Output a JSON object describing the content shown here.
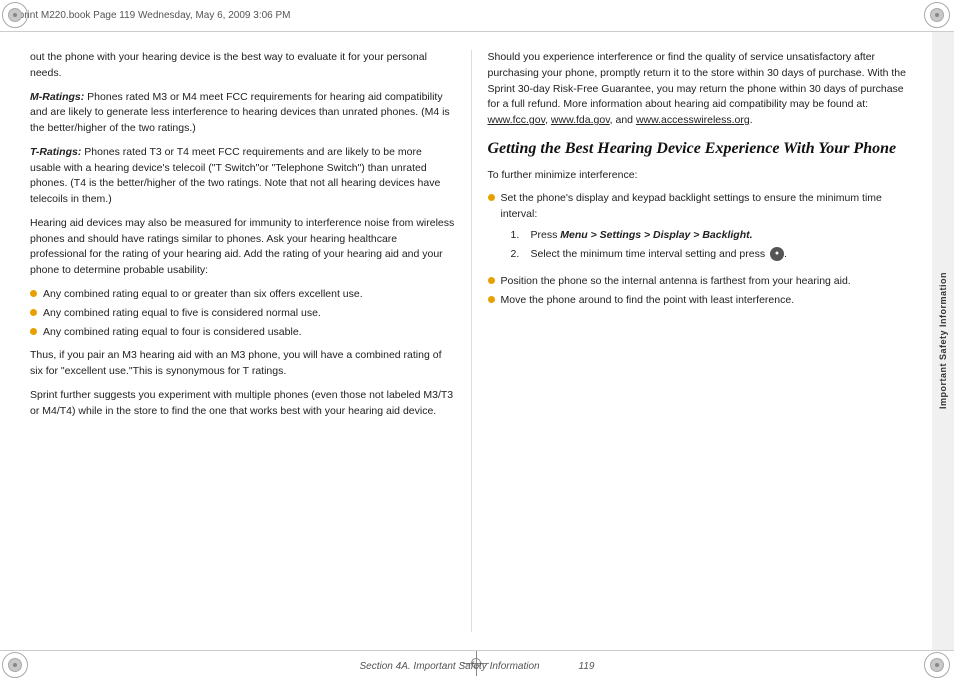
{
  "header": {
    "text": "Sprint M220.book  Page 119  Wednesday, May 6, 2009  3:06 PM"
  },
  "footer": {
    "section_label": "Section 4A. Important Safety Information",
    "page_number": "119"
  },
  "sidebar": {
    "label": "Important Safety Information"
  },
  "left_column": {
    "intro_text": "out the phone with your hearing device is the best way to evaluate it for your personal needs.",
    "m_ratings_label": "M-Ratings:",
    "m_ratings_text": "Phones rated M3 or M4 meet FCC requirements for hearing aid compatibility and are likely to generate less interference to hearing devices than unrated phones. (M4 is the better/higher of the two ratings.)",
    "t_ratings_label": "T-Ratings:",
    "t_ratings_text": "Phones rated T3 or T4 meet FCC requirements and are likely to be more usable with a hearing device's telecoil (\"T Switch\"or \"Telephone Switch\") than unrated phones. (T4 is the better/higher of the two ratings. Note that not all hearing devices have telecoils in them.)",
    "hearing_aid_para": "Hearing aid devices may also be measured for immunity to interference noise from wireless phones and should have ratings similar to phones. Ask your hearing healthcare professional for the rating of your hearing aid. Add the rating of your hearing aid and your phone to determine probable usability:",
    "bullets": [
      "Any combined rating equal to or greater than six offers excellent use.",
      "Any combined rating equal to five is considered normal use.",
      "Any combined rating equal to four is considered usable."
    ],
    "thus_para": "Thus, if you pair an M3 hearing aid with an M3 phone, you will have a combined rating of six for \"excellent use.\"This is synonymous for T ratings.",
    "sprint_para": "Sprint further suggests you experiment with multiple phones (even those not labeled M3/T3 or M4/T4) while in the store to find the one that works best with your hearing aid device."
  },
  "right_column": {
    "intro_para": "Should you experience interference or find the quality of service unsatisfactory after purchasing your phone, promptly return it to the store within 30 days of purchase. With the Sprint 30-day Risk-Free Guarantee, you may return the phone within 30 days of purchase for a full refund. More information about hearing aid compatibility may be found at:",
    "link1": "www.fcc.gov",
    "link2": "www.fda.gov",
    "link3": "www.accesswireless.org",
    "heading": "Getting the Best Hearing Device Experience With Your Phone",
    "further_minimize": "To further minimize interference:",
    "bullet1": "Set the phone's display and keypad backlight settings to ensure the minimum time interval:",
    "step1_label": "1.",
    "step1_text": "Press Menu > Settings > Display > Backlight.",
    "step2_label": "2.",
    "step2_text": "Select the minimum time interval setting and press",
    "menu_btn_label": "MENU",
    "bullet2": "Position the phone so the internal antenna is farthest from your hearing aid.",
    "bullet3": "Move the phone around to find the point with least interference."
  }
}
